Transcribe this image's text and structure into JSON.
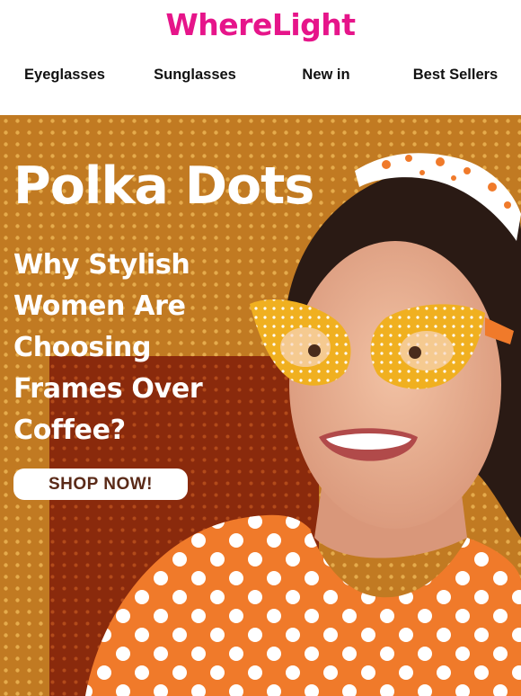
{
  "brand": {
    "name": "WhereLight",
    "color": "#e6158a"
  },
  "nav": {
    "items": [
      {
        "label": "Eyeglasses"
      },
      {
        "label": "Sunglasses"
      },
      {
        "label": "New in"
      },
      {
        "label": "Best Sellers"
      }
    ]
  },
  "hero": {
    "headline": "Polka Dots",
    "subhead": "Why Stylish Women Are Choosing Frames Over Coffee?",
    "cta_label": "SHOP NOW!",
    "cta_text_color": "#5a2a18",
    "colors": {
      "background": "#c17a22",
      "accent_dark": "#8a2a0c",
      "dots": "#e9b050"
    }
  }
}
